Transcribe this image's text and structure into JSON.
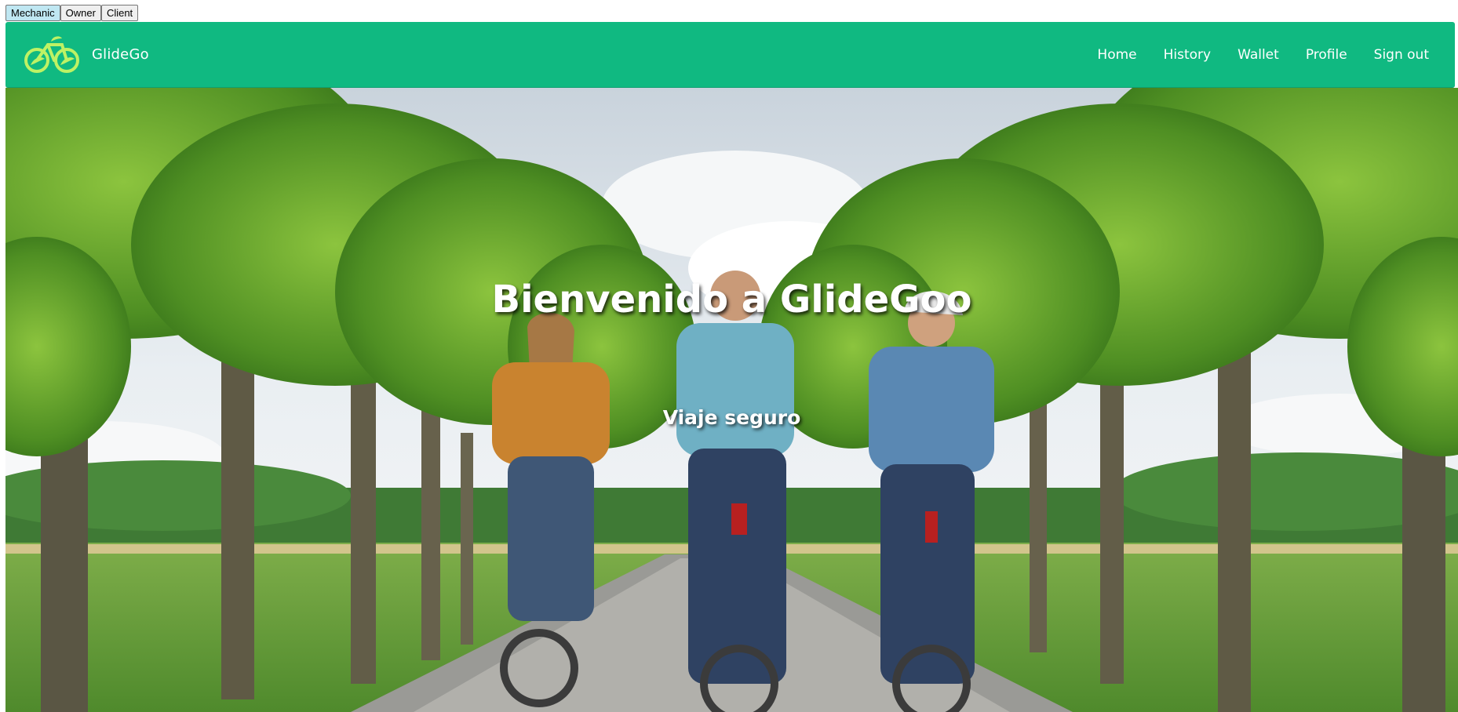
{
  "roles": {
    "items": [
      "Mechanic",
      "Owner",
      "Client"
    ],
    "active": "Mechanic"
  },
  "navbar": {
    "brand_name": "GlideGo",
    "links": [
      "Home",
      "History",
      "Wallet",
      "Profile",
      "Sign out"
    ],
    "background": "#10b981",
    "logo_color": "#bef264"
  },
  "hero": {
    "title": "Bienvenido a GlideGoo",
    "subtitle": "Viaje seguro"
  }
}
